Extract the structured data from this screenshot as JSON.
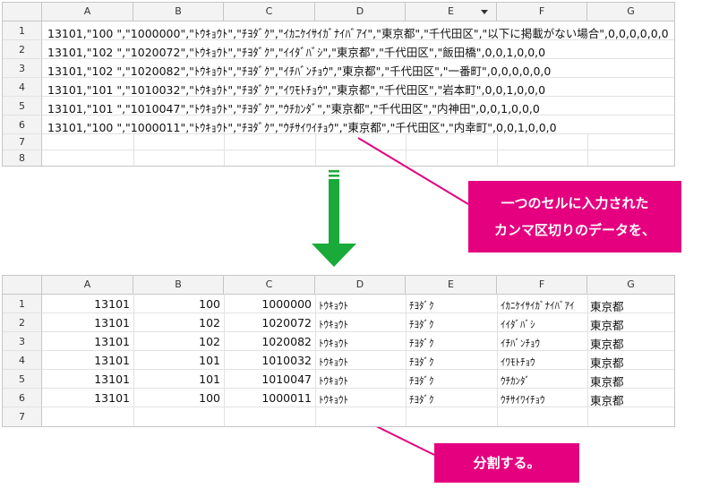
{
  "columns": [
    "A",
    "B",
    "C",
    "D",
    "E",
    "F",
    "G"
  ],
  "top": {
    "rows": [
      "1",
      "2",
      "3",
      "4",
      "5",
      "6",
      "7",
      "8"
    ],
    "cells": [
      "13101,\"100  \",\"1000000\",\"ﾄｳｷｮｳﾄ\",\"ﾁﾖﾀﾞｸ\",\"ｲｶﾆｹｲｻｲｶﾞﾅｲﾊﾞｱｲ\",\"東京都\",\"千代田区\",\"以下に掲載がない場合\",0,0,0,0,0,0",
      "13101,\"102  \",\"1020072\",\"ﾄｳｷｮｳﾄ\",\"ﾁﾖﾀﾞｸ\",\"ｲｲﾀﾞﾊﾞｼ\",\"東京都\",\"千代田区\",\"飯田橋\",0,0,1,0,0,0",
      "13101,\"102  \",\"1020082\",\"ﾄｳｷｮｳﾄ\",\"ﾁﾖﾀﾞｸ\",\"ｲﾁﾊﾞﾝﾁｮｳ\",\"東京都\",\"千代田区\",\"一番町\",0,0,0,0,0,0",
      "13101,\"101  \",\"1010032\",\"ﾄｳｷｮｳﾄ\",\"ﾁﾖﾀﾞｸ\",\"ｲﾜﾓﾄﾁｮｳ\",\"東京都\",\"千代田区\",\"岩本町\",0,0,1,0,0,0",
      "13101,\"101  \",\"1010047\",\"ﾄｳｷｮｳﾄ\",\"ﾁﾖﾀﾞｸ\",\"ｳﾁｶﾝﾀﾞ\",\"東京都\",\"千代田区\",\"内神田\",0,0,1,0,0,0",
      "13101,\"100  \",\"1000011\",\"ﾄｳｷｮｳﾄ\",\"ﾁﾖﾀﾞｸ\",\"ｳﾁｻｲﾜｲﾁｮｳ\",\"東京都\",\"千代田区\",\"内幸町\",0,0,1,0,0,0"
    ]
  },
  "bottom": {
    "rows": [
      "1",
      "2",
      "3",
      "4",
      "5",
      "6",
      "7"
    ],
    "cells": [
      [
        "13101",
        "100",
        "1000000",
        "ﾄｳｷｮｳﾄ",
        "ﾁﾖﾀﾞｸ",
        "ｲｶﾆｹｲｻｲｶﾞﾅｲﾊﾞｱｲ",
        "東京都"
      ],
      [
        "13101",
        "102",
        "1020072",
        "ﾄｳｷｮｳﾄ",
        "ﾁﾖﾀﾞｸ",
        "ｲｲﾀﾞﾊﾞｼ",
        "東京都"
      ],
      [
        "13101",
        "102",
        "1020082",
        "ﾄｳｷｮｳﾄ",
        "ﾁﾖﾀﾞｸ",
        "ｲﾁﾊﾞﾝﾁｮｳ",
        "東京都"
      ],
      [
        "13101",
        "101",
        "1010032",
        "ﾄｳｷｮｳﾄ",
        "ﾁﾖﾀﾞｸ",
        "ｲﾜﾓﾄﾁｮｳ",
        "東京都"
      ],
      [
        "13101",
        "101",
        "1010047",
        "ﾄｳｷｮｳﾄ",
        "ﾁﾖﾀﾞｸ",
        "ｳﾁｶﾝﾀﾞ",
        "東京都"
      ],
      [
        "13101",
        "100",
        "1000011",
        "ﾄｳｷｮｳﾄ",
        "ﾁﾖﾀﾞｸ",
        "ｳﾁｻｲﾜｲﾁｮｳ",
        "東京都"
      ]
    ]
  },
  "callout1": {
    "line1": "一つのセルに入力された",
    "line2": "カンマ区切りのデータを、"
  },
  "callout2": {
    "text": "分割する。"
  },
  "colors": {
    "accent": "#e4007f",
    "arrow": "#1aaa3a"
  },
  "icons": {
    "filter": "filter-dropdown-icon",
    "arrow": "down-arrow-icon"
  }
}
